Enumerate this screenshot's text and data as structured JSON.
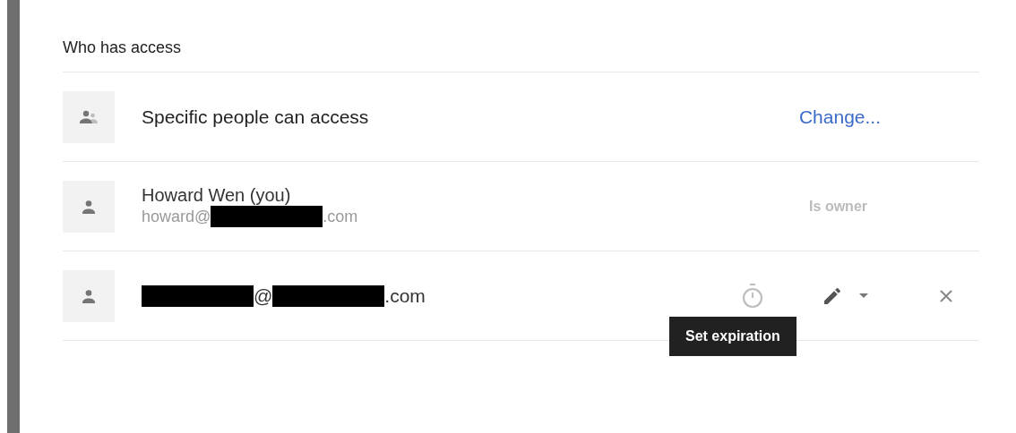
{
  "heading": "Who has access",
  "general": {
    "label": "Specific people can access",
    "action": "Change..."
  },
  "people": [
    {
      "name": "Howard Wen (you)",
      "email": [
        {
          "kind": "text",
          "text": "howard@"
        },
        {
          "kind": "redacted"
        },
        {
          "kind": "text",
          "text": ".com"
        }
      ],
      "role": "Is owner",
      "editable": false
    },
    {
      "email": [
        {
          "kind": "redacted"
        },
        {
          "kind": "text",
          "text": "@"
        },
        {
          "kind": "redacted"
        },
        {
          "kind": "text",
          "text": ".com"
        }
      ],
      "editable": true
    }
  ],
  "tooltip": "Set expiration"
}
